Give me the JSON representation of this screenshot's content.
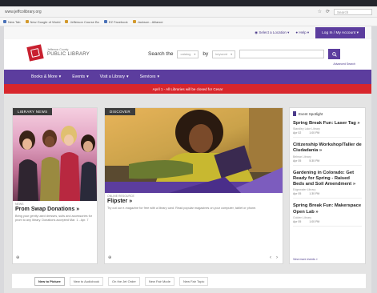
{
  "browser": {
    "url": "www.jeffcolibrary.org",
    "search_placeholder": "Search",
    "bookmarks": [
      "New Tab",
      "New Google of World",
      "Jefferson Course Bo",
      "EZ Facebook",
      "Jackson - Alliance"
    ]
  },
  "util": {
    "links": [
      "Select a Location",
      "Help"
    ],
    "login_label": "Log In / My Account"
  },
  "header": {
    "logo_small": "Jefferson County",
    "logo_big": "PUBLIC LIBRARY",
    "search_label": "Search the",
    "catalog_select": "catalog",
    "by_label": "by",
    "keyword_select": "keyword",
    "advanced_search": "Advanced Search"
  },
  "nav": {
    "items": [
      "Books & More",
      "Events",
      "Visit a Library",
      "Services"
    ]
  },
  "alert": {
    "text": "April 1 - All Libraries will be closed for Cesar"
  },
  "cards": [
    {
      "tag": "LIBRARY NEWS",
      "kicker": "NEWS",
      "title": "Prom Swap Donations »",
      "text": "Bring your gently used dresses, suits and accessories for prom to any library. Donations accepted Mar. 1 - Apr. 7"
    },
    {
      "tag": "DISCOVER",
      "kicker": "ONLINE RESOURCE",
      "title": "Flipster »",
      "text": "Try out our e-magazine for free with a library card. Read popular magazines on your computer, tablet or phone."
    }
  ],
  "spotlight": {
    "title": "Event Spotlight",
    "items": [
      {
        "title": "Spring Break Fun: Laser Tag »",
        "meta": "Standley Lake Library",
        "date": "Apr 02",
        "time": "1:00 PM"
      },
      {
        "title": "Citizenship Workshop/Taller de Ciudadania »",
        "meta": "Belmar Library",
        "date": "Apr 05",
        "time": "5:30 PM"
      },
      {
        "title": "Gardening in Colorado: Get Ready for Spring - Raised Beds and Soil Amendment »",
        "meta": "Edgewater Library",
        "date": "Apr 05",
        "time": "1:30 PM"
      },
      {
        "title": "Spring Break Fun: Makerspace Open Lab »",
        "meta": "Golden Library",
        "date": "Apr 05",
        "time": "1:00 PM"
      }
    ],
    "view_more": "View more events »"
  },
  "tabs": [
    "New to Picture",
    "New to Audiobook",
    "On the Jet Order",
    "New Fair Mode",
    "New Fair Topic"
  ]
}
